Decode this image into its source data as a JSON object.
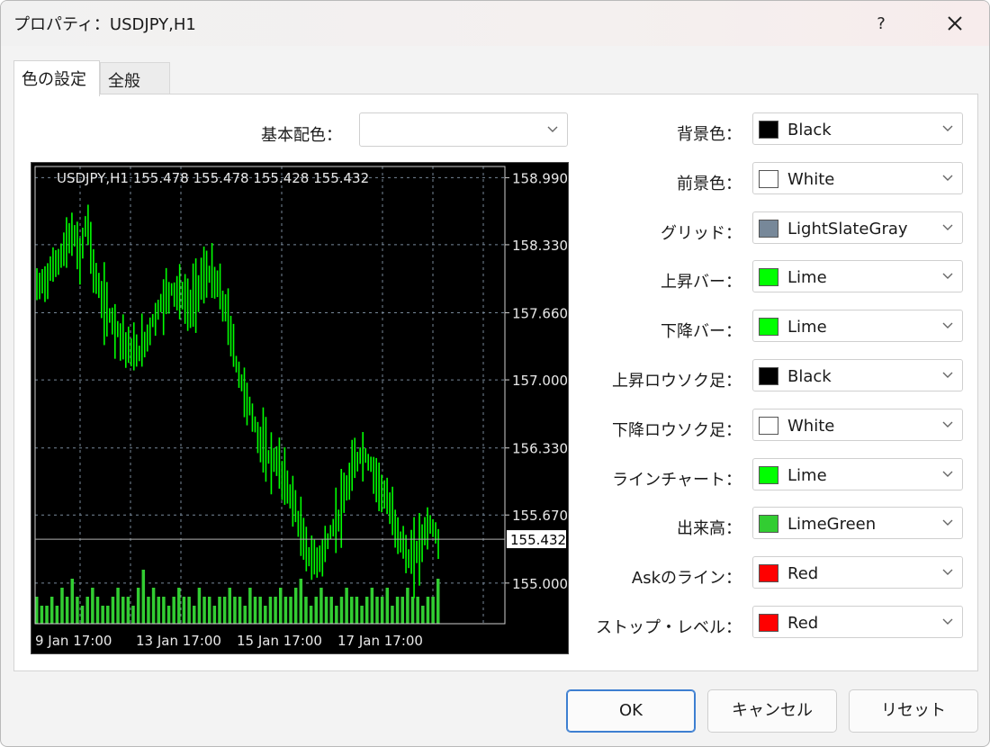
{
  "window": {
    "title": "プロパティ：USDJPY,H1",
    "help_label": "?",
    "close_icon": "close-icon"
  },
  "tabs": [
    {
      "label": "色の設定",
      "active": true
    },
    {
      "label": "全般",
      "active": false
    }
  ],
  "basic": {
    "label": "基本配色：",
    "value": ""
  },
  "properties": [
    {
      "label": "背景色：",
      "value": "Black",
      "color": "#000000"
    },
    {
      "label": "前景色：",
      "value": "White",
      "color": "#ffffff"
    },
    {
      "label": "グリッド：",
      "value": "LightSlateGray",
      "color": "#778899"
    },
    {
      "label": "上昇バー：",
      "value": "Lime",
      "color": "#00ff00"
    },
    {
      "label": "下降バー：",
      "value": "Lime",
      "color": "#00ff00"
    },
    {
      "label": "上昇ロウソク足：",
      "value": "Black",
      "color": "#000000"
    },
    {
      "label": "下降ロウソク足：",
      "value": "White",
      "color": "#ffffff"
    },
    {
      "label": "ラインチャート：",
      "value": "Lime",
      "color": "#00ff00"
    },
    {
      "label": "出来高：",
      "value": "LimeGreen",
      "color": "#32cd32"
    },
    {
      "label": "Askのライン：",
      "value": "Red",
      "color": "#ff0000"
    },
    {
      "label": "ストップ・レベル：",
      "value": "Red",
      "color": "#ff0000"
    }
  ],
  "buttons": {
    "ok": "OK",
    "cancel": "キャンセル",
    "reset": "リセット"
  },
  "chart_data": {
    "type": "bar",
    "header": "USDJPY,H1  155.478 155.478 155.428 155.432",
    "y_ticks": [
      "158.990",
      "158.330",
      "157.660",
      "157.000",
      "156.330",
      "155.670",
      "155.000"
    ],
    "y_tick_values": [
      158.99,
      158.33,
      157.66,
      157.0,
      156.33,
      155.67,
      155.0
    ],
    "x_ticks": [
      "9 Jan 17:00",
      "13 Jan 17:00",
      "15 Jan 17:00",
      "17 Jan 17:00"
    ],
    "current_price": "155.432",
    "current_price_value": 155.432,
    "ylim": [
      154.6,
      159.1
    ],
    "background": "#000000",
    "bar_color": "#00ff00",
    "volume_color": "#32cd32",
    "grid_color": "#778899",
    "grid": true,
    "price_path": [
      [
        0,
        157.9
      ],
      [
        4,
        158.0
      ],
      [
        8,
        158.15
      ],
      [
        12,
        158.3
      ],
      [
        15,
        158.45
      ],
      [
        18,
        158.2
      ],
      [
        21,
        158.6
      ],
      [
        24,
        158.05
      ],
      [
        27,
        157.8
      ],
      [
        30,
        157.65
      ],
      [
        33,
        157.55
      ],
      [
        36,
        157.4
      ],
      [
        40,
        157.25
      ],
      [
        44,
        157.3
      ],
      [
        48,
        157.55
      ],
      [
        52,
        157.75
      ],
      [
        56,
        157.9
      ],
      [
        60,
        157.85
      ],
      [
        64,
        157.7
      ],
      [
        68,
        157.95
      ],
      [
        72,
        158.05
      ],
      [
        76,
        157.9
      ],
      [
        80,
        157.6
      ],
      [
        84,
        157.1
      ],
      [
        88,
        156.8
      ],
      [
        92,
        156.5
      ],
      [
        96,
        156.25
      ],
      [
        100,
        156.2
      ],
      [
        104,
        156.0
      ],
      [
        108,
        155.75
      ],
      [
        112,
        155.35
      ],
      [
        116,
        155.2
      ],
      [
        120,
        155.3
      ],
      [
        124,
        155.55
      ],
      [
        128,
        155.75
      ],
      [
        132,
        156.1
      ],
      [
        136,
        156.3
      ],
      [
        140,
        156.15
      ],
      [
        144,
        155.95
      ],
      [
        148,
        155.7
      ],
      [
        152,
        155.45
      ],
      [
        156,
        155.2
      ],
      [
        160,
        155.35
      ],
      [
        164,
        155.6
      ],
      [
        168,
        155.432
      ]
    ],
    "volume": [
      3,
      2,
      2,
      3,
      2,
      4,
      3,
      5,
      3,
      2,
      3,
      4,
      3,
      2,
      2,
      3,
      4,
      3,
      3,
      2,
      4,
      6,
      3,
      4,
      3,
      3,
      2,
      3,
      4,
      3,
      3,
      2,
      4,
      3,
      3,
      2,
      3,
      3,
      4,
      3,
      3,
      2,
      4,
      3,
      3,
      2,
      3,
      3,
      4,
      3,
      3,
      4,
      5,
      3,
      2,
      3,
      4,
      3,
      3,
      2,
      3,
      4,
      3,
      3,
      2,
      3,
      4,
      3,
      3,
      4,
      2,
      3,
      3,
      4,
      3,
      3,
      2,
      3,
      3,
      5
    ]
  }
}
